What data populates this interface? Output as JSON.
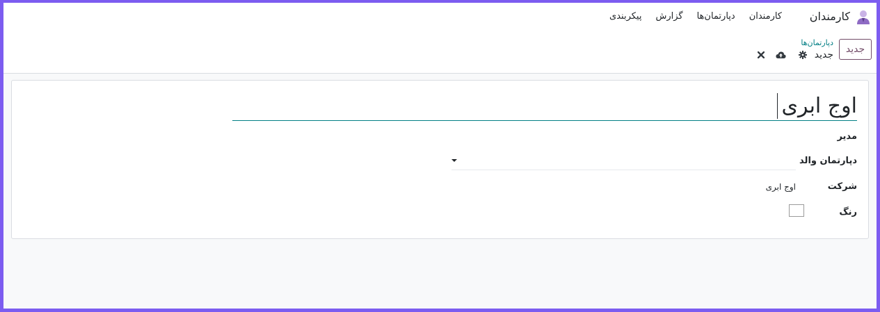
{
  "navbar": {
    "app_name": "کارمندان",
    "menu": [
      "کارمندان",
      "دپارتمان‌ها",
      "گزارش",
      "پیکربندی"
    ]
  },
  "control_panel": {
    "new_button": "جدید",
    "breadcrumb_parent": "دپارتمان‌ها",
    "breadcrumb_current": "جدید",
    "icons": [
      "gear-icon",
      "cloud-upload-icon",
      "close-icon"
    ]
  },
  "form": {
    "name_value": "اوج ابری",
    "manager_label": "مدیر",
    "parent_label": "دپارتمان والد",
    "parent_value": "",
    "company_label": "شرکت",
    "company_value": "اوج ابری",
    "color_label": "رنگ"
  },
  "colors": {
    "frame": "#7c5cf0",
    "primary": "#714b67",
    "accent": "#017e84"
  }
}
